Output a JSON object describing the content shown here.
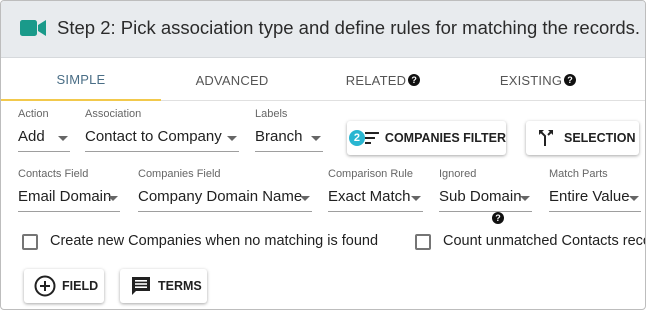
{
  "header": {
    "title": "Step 2: Pick association type and define rules for matching the records.",
    "icon": "video-camera-icon",
    "icon_color": "#1a9a8a"
  },
  "tabs": [
    {
      "label": "SIMPLE",
      "active": true
    },
    {
      "label": "ADVANCED",
      "active": false
    },
    {
      "label": "RELATED",
      "active": false,
      "help": true
    },
    {
      "label": "EXISTING",
      "active": false,
      "help": true
    }
  ],
  "row1": {
    "action": {
      "label": "Action",
      "value": "Add"
    },
    "association": {
      "label": "Association",
      "value": "Contact to Company"
    },
    "labels": {
      "label": "Labels",
      "value": "Branch"
    },
    "filter_button": {
      "badge": "2",
      "label": "COMPANIES FILTER"
    },
    "selection_button": {
      "label": "SELECTION"
    }
  },
  "row2": {
    "contacts_field": {
      "label": "Contacts Field",
      "value": "Email Domain"
    },
    "companies_field": {
      "label": "Companies Field",
      "value": "Company Domain Name"
    },
    "comparison_rule": {
      "label": "Comparison Rule",
      "value": "Exact Match"
    },
    "ignored": {
      "label": "Ignored",
      "value": "Sub Domain"
    },
    "match_parts": {
      "label": "Match Parts",
      "value": "Entire Value"
    }
  },
  "checkboxes": {
    "create_new": {
      "label": "Create new Companies when no matching is found",
      "checked": false
    },
    "count_unmatched": {
      "label": "Count unmatched Contacts reco",
      "checked": false
    }
  },
  "bottom_buttons": {
    "field": {
      "label": "FIELD"
    },
    "terms": {
      "label": "TERMS"
    }
  },
  "colors": {
    "accent_tab": "#4a6e86",
    "tab_underline": "#f2c94c",
    "badge": "#29b6d1",
    "header_bg": "#e8ebee"
  }
}
